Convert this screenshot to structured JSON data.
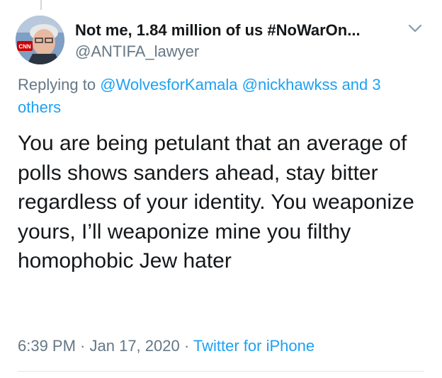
{
  "tweet": {
    "display_name": "Not me, 1.84 million of us #NoWarOn...",
    "handle": "@ANTIFA_lawyer",
    "avatar_badge_text": "CNN",
    "replying_to_prefix": "Replying to ",
    "replying_to_mentions": "@WolvesforKamala @nickhawkss",
    "replying_to_others": " and 3 others",
    "text": "You are being petulant that an average of polls shows sanders ahead, stay bitter regardless of your identity. You weaponize yours, I’ll weaponize mine you filthy homophobic Jew hater",
    "time": "6:39 PM",
    "separator1": " · ",
    "date": "Jan 17, 2020",
    "separator2": " · ",
    "source": "Twitter for iPhone"
  },
  "icons": {
    "menu_caret": "chevron-down-icon"
  },
  "colors": {
    "link": "#1da1f2",
    "secondary_text": "#657786",
    "primary_text": "#14171a"
  }
}
